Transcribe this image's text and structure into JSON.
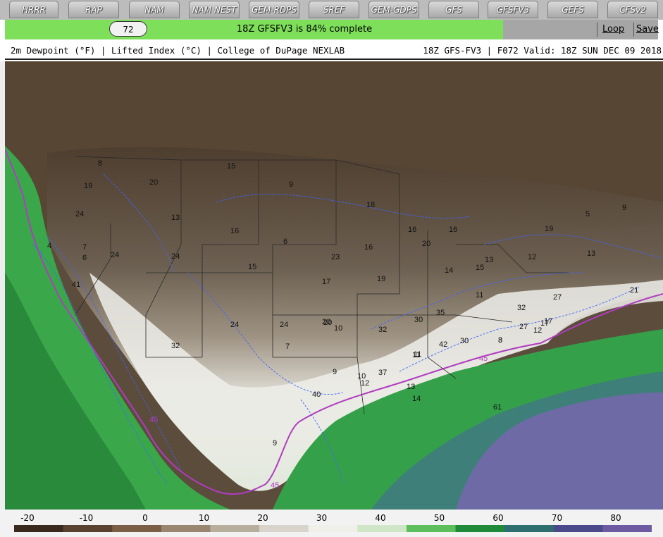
{
  "tabs": [
    {
      "label": "HRRR"
    },
    {
      "label": "RAP"
    },
    {
      "label": "NAM"
    },
    {
      "label": "NAM NEST"
    },
    {
      "label": "GEM-RDPS"
    },
    {
      "label": "SREF"
    },
    {
      "label": "GEM-GDPS"
    },
    {
      "label": "GFS"
    },
    {
      "label": "GFSFV3"
    },
    {
      "label": "GEFS"
    },
    {
      "label": "CFSv2"
    }
  ],
  "status": {
    "frame": "72",
    "message": "18Z GFSFV3 is 84% complete",
    "progress": 0.84,
    "loop_label": "Loop",
    "save_label": "Save"
  },
  "info": {
    "left": "2m Dewpoint (°F) | Lifted Index (°C) | College of DuPage NEXLAB",
    "right": "18Z GFS-FV3 | F072 Valid: 18Z SUN DEC 09 2018"
  },
  "map": {
    "dewpoint_labels": [
      "8",
      "19",
      "20",
      "15",
      "9",
      "24",
      "13",
      "16",
      "18",
      "16",
      "16",
      "19",
      "5",
      "9",
      "24",
      "24",
      "15",
      "20",
      "23",
      "16",
      "12",
      "13",
      "41",
      "17",
      "19",
      "15",
      "27",
      "10",
      "11",
      "35",
      "30",
      "21",
      "24",
      "24",
      "20",
      "32",
      "27",
      "32",
      "20",
      "32",
      "30",
      "42",
      "3",
      "17",
      "12",
      "45",
      "37",
      "40",
      "11",
      "9",
      "61",
      "45",
      "45",
      "9",
      "12",
      "13",
      "14",
      "10",
      "6",
      "7",
      "4",
      "6",
      "14",
      "11",
      "13",
      "8",
      "7",
      "17"
    ]
  },
  "colorscale": {
    "labels": [
      "-20",
      "-10",
      "0",
      "10",
      "20",
      "30",
      "40",
      "50",
      "60",
      "70",
      "80"
    ],
    "colors": [
      "#3a2a1e",
      "#5a4230",
      "#7a5e46",
      "#9a8570",
      "#b8ae9e",
      "#d8d4cc",
      "#f0f0ea",
      "#cfe6c7",
      "#5cbf5c",
      "#1e8a3a",
      "#2e6e6e",
      "#4a4a8a",
      "#6e5aa0"
    ]
  },
  "colors": {
    "progress": "#7ddf5a",
    "contour_45": "#b03cc0",
    "lifted_index": "#3c64ff"
  }
}
